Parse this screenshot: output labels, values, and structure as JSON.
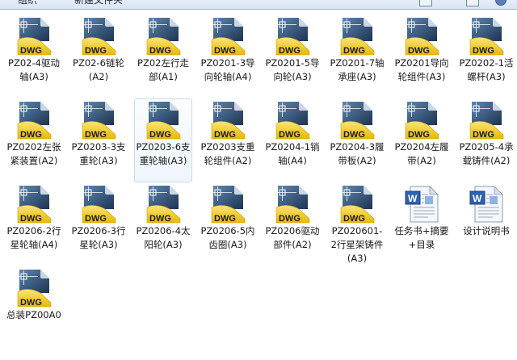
{
  "toolbar": {
    "organize": "组织",
    "new_folder": "新建文件夹"
  },
  "colors": {
    "dwg_yellow": "#f1c40f",
    "dwg_blue": "#2a4a70",
    "selection": "#c5dcf0"
  },
  "files": [
    {
      "name": "PZ02-4驱动轴(A3)",
      "type": "dwg"
    },
    {
      "name": "PZ02-6链轮(A2)",
      "type": "dwg"
    },
    {
      "name": "PZ02左行走部(A1)",
      "type": "dwg"
    },
    {
      "name": "PZ0201-3导向轮轴(A4)",
      "type": "dwg"
    },
    {
      "name": "PZ0201-5导向轮(A3)",
      "type": "dwg"
    },
    {
      "name": "PZ0201-7轴承座(A3)",
      "type": "dwg"
    },
    {
      "name": "PZ0201导向轮组件(A3)",
      "type": "dwg"
    },
    {
      "name": "PZ0202-1活螺杆(A3)",
      "type": "dwg"
    },
    {
      "name": "PZ0202左张紧装置(A2)",
      "type": "dwg"
    },
    {
      "name": "PZ0203-3支重轮(A3)",
      "type": "dwg"
    },
    {
      "name": "PZ0203-6支重轮轴(A3)",
      "type": "dwg",
      "selected": true
    },
    {
      "name": "PZ0203支重轮组件(A2)",
      "type": "dwg"
    },
    {
      "name": "PZ0204-1销轴(A4)",
      "type": "dwg"
    },
    {
      "name": "PZ0204-3履带板(A2)",
      "type": "dwg"
    },
    {
      "name": "PZ0204左履带(A2)",
      "type": "dwg"
    },
    {
      "name": "PZ0205-4承载铸件(A2)",
      "type": "dwg"
    },
    {
      "name": "PZ0206-2行星轮轴(A4)",
      "type": "dwg"
    },
    {
      "name": "PZ0206-3行星轮(A3)",
      "type": "dwg"
    },
    {
      "name": "PZ0206-4太阳轮(A3)",
      "type": "dwg"
    },
    {
      "name": "PZ0206-5内齿圈(A3)",
      "type": "dwg"
    },
    {
      "name": "PZ0206驱动部件(A2)",
      "type": "dwg"
    },
    {
      "name": "PZ020601-2行星架铸件(A3)",
      "type": "dwg"
    },
    {
      "name": "任务书+摘要+目录",
      "type": "doc"
    },
    {
      "name": "设计说明书",
      "type": "doc"
    },
    {
      "name": "总装PZ00A0",
      "type": "dwg"
    }
  ],
  "dwg_badge": "DWG"
}
